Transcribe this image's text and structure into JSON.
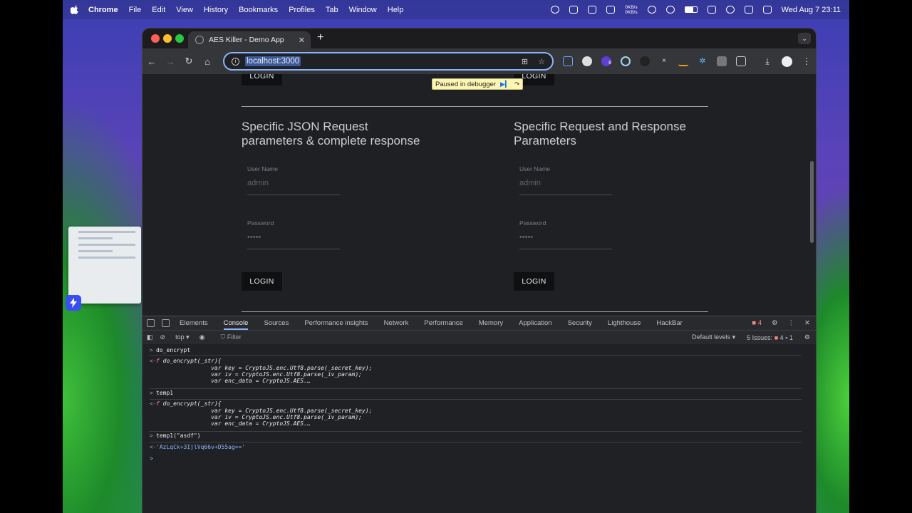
{
  "menubar": {
    "app": "Chrome",
    "items": [
      "File",
      "Edit",
      "View",
      "History",
      "Bookmarks",
      "Profiles",
      "Tab",
      "Window",
      "Help"
    ],
    "net_up": "0KB/s",
    "net_down": "0KB/s",
    "clock": "Wed Aug 7  23:11"
  },
  "browser": {
    "tab_title": "AES Killer - Demo App",
    "url": "localhost:3000",
    "extension_badge": "8"
  },
  "page": {
    "top_login_left": "LOGIN",
    "top_login_right": "LOGIN",
    "paused_label": "Paused in debugger",
    "left": {
      "heading_line1": "Specific JSON Request",
      "heading_line2": "parameters & complete response",
      "username_label": "User Name",
      "username_value": "admin",
      "password_label": "Password",
      "password_value": "•••••",
      "login_label": "LOGIN"
    },
    "right": {
      "heading_line1": "Specific Request and Response",
      "heading_line2": "Parameters",
      "username_label": "User Name",
      "username_value": "admin",
      "password_label": "Password",
      "password_value": "•••••",
      "login_label": "LOGIN"
    }
  },
  "devtools": {
    "tabs": [
      "Elements",
      "Console",
      "Sources",
      "Performance insights",
      "Network",
      "Performance",
      "Memory",
      "Application",
      "Security",
      "Lighthouse",
      "HackBar"
    ],
    "active_tab": "Console",
    "error_count": "4",
    "context": "top",
    "filter_placeholder": "Filter",
    "levels": "Default levels",
    "issues_label": "5 Issues:",
    "issues_warn": "4",
    "issues_info": "1"
  },
  "console": {
    "entries": [
      {
        "prompt": ">",
        "text": "do_encrypt"
      },
      {
        "prompt": "<·",
        "fn": "f",
        "line1": " do_encrypt(_str){",
        "line2": "                var key = CryptoJS.enc.Utf8.parse(_secret_key);",
        "line3": "                var iv = CryptoJS.enc.Utf8.parse(_iv_param);",
        "line4": "                var enc_data = CryptoJS.AES.…"
      },
      {
        "prompt": ">",
        "text": "temp1"
      },
      {
        "prompt": "<·",
        "fn": "f",
        "line1": " do_encrypt(_str){",
        "line2": "                var key = CryptoJS.enc.Utf8.parse(_secret_key);",
        "line3": "                var iv = CryptoJS.enc.Utf8.parse(_iv_param);",
        "line4": "                var enc_data = CryptoJS.AES.…"
      },
      {
        "prompt": ">",
        "text": "temp1(\"asdf\")"
      },
      {
        "prompt": "<·",
        "text": "'AzLqCk+3IjlVq66v+D55ag=='"
      },
      {
        "prompt": ">",
        "text": ""
      }
    ]
  }
}
